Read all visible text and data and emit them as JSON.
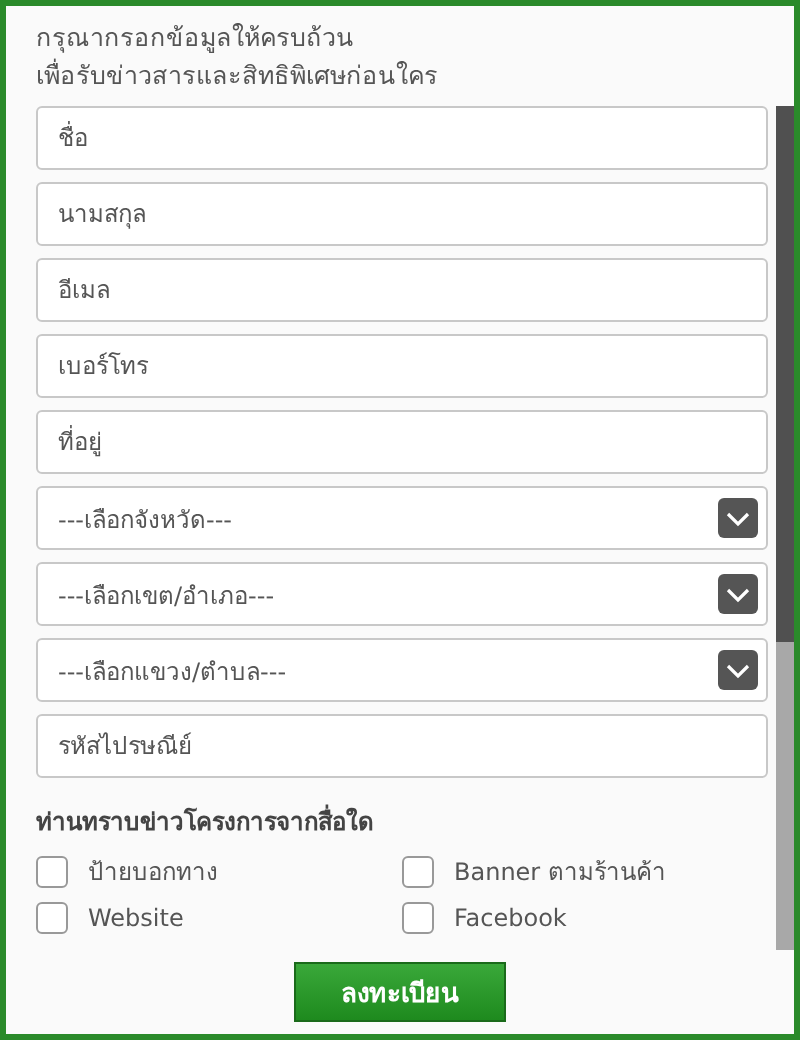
{
  "header": {
    "lines": [
      "กรุณากรอกข้อมูลให้ครบถ้วน",
      "เพื่อรับข่าวสารและสิทธิพิเศษก่อนใคร"
    ]
  },
  "fields": [
    {
      "kind": "text",
      "placeholder": "ชื่อ"
    },
    {
      "kind": "text",
      "placeholder": "นามสกุล"
    },
    {
      "kind": "text",
      "placeholder": "อีเมล"
    },
    {
      "kind": "text",
      "placeholder": "เบอร์โทร"
    },
    {
      "kind": "text",
      "placeholder": "ที่อยู่"
    },
    {
      "kind": "select",
      "placeholder": "---เลือกจังหวัด---"
    },
    {
      "kind": "select",
      "placeholder": "---เลือกเขต/อำเภอ---"
    },
    {
      "kind": "select",
      "placeholder": "---เลือกแขวง/ตำบล---"
    },
    {
      "kind": "text",
      "placeholder": "รหัสไปรษณีย์"
    }
  ],
  "sources": {
    "title": "ท่านทราบข่าวโครงการจากสื่อใด",
    "options": [
      {
        "label": "ป้ายบอกทาง",
        "checked": false
      },
      {
        "label": "Banner ตามร้านค้า",
        "checked": false
      },
      {
        "label": "Website",
        "checked": false
      },
      {
        "label": "Facebook",
        "checked": false
      }
    ]
  },
  "submit": {
    "label": "ลงทะเบียน"
  }
}
